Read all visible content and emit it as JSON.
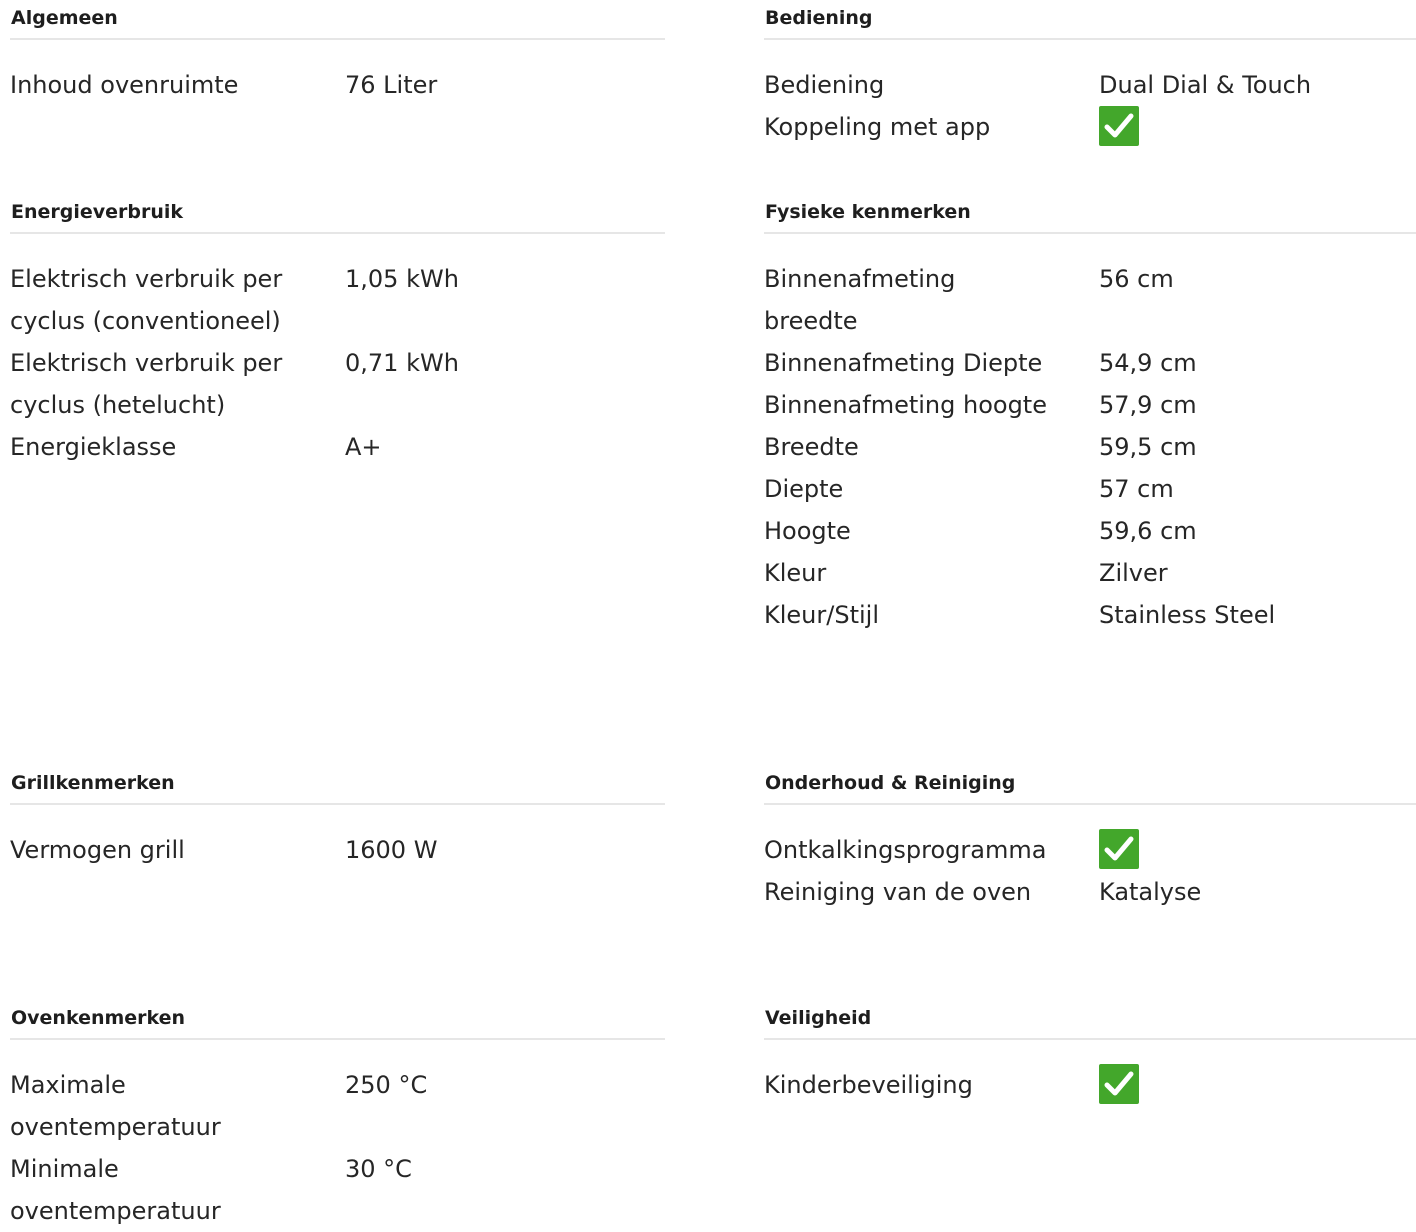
{
  "check_color": "#43a72b",
  "sections": {
    "algemeen": {
      "title": "Algemeen",
      "rows": [
        {
          "label": "Inhoud ovenruimte",
          "value": "76 Liter"
        }
      ]
    },
    "bediening": {
      "title": "Bediening",
      "rows": [
        {
          "label": "Bediening",
          "value": "Dual Dial & Touch"
        },
        {
          "label": "Koppeling met app",
          "value_icon": "check-icon"
        }
      ]
    },
    "energieverbruik": {
      "title": "Energieverbruik",
      "rows": [
        {
          "label": "Elektrisch verbruik per cyclus (conventioneel)",
          "value": "1,05 kWh"
        },
        {
          "label": "Elektrisch verbruik per cyclus (hetelucht)",
          "value": "0,71 kWh"
        },
        {
          "label": "Energieklasse",
          "value": "A+"
        }
      ]
    },
    "fysieke": {
      "title": "Fysieke kenmerken",
      "rows": [
        {
          "label": "Binnenafmeting breedte",
          "value": "56 cm"
        },
        {
          "label": "Binnenafmeting Diepte",
          "value": "54,9 cm"
        },
        {
          "label": "Binnenafmeting hoogte",
          "value": "57,9 cm"
        },
        {
          "label": "Breedte",
          "value": "59,5 cm"
        },
        {
          "label": "Diepte",
          "value": "57 cm"
        },
        {
          "label": "Hoogte",
          "value": "59,6 cm"
        },
        {
          "label": "Kleur",
          "value": "Zilver"
        },
        {
          "label": "Kleur/Stijl",
          "value": "Stainless Steel"
        }
      ]
    },
    "grill": {
      "title": "Grillkenmerken",
      "rows": [
        {
          "label": "Vermogen grill",
          "value": "1600 W"
        }
      ]
    },
    "onderhoud": {
      "title": "Onderhoud & Reiniging",
      "rows": [
        {
          "label": "Ontkalkingsprogramma",
          "value_icon": "check-icon"
        },
        {
          "label": "Reiniging van de oven",
          "value": "Katalyse"
        }
      ]
    },
    "oven": {
      "title": "Ovenkenmerken",
      "rows": [
        {
          "label": "Maximale oventemperatuur",
          "value": "250 °C"
        },
        {
          "label": "Minimale oventemperatuur",
          "value": "30 °C"
        }
      ]
    },
    "veiligheid": {
      "title": "Veiligheid",
      "rows": [
        {
          "label": "Kinderbeveiliging",
          "value_icon": "check-icon"
        }
      ]
    }
  }
}
